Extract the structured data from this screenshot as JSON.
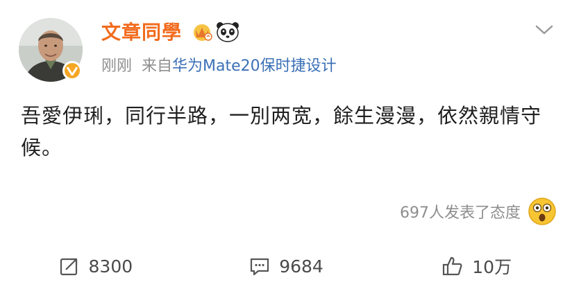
{
  "post": {
    "author": "文章同學",
    "time": "刚刚",
    "source_prefix": "来自",
    "device": "华为Mate20保时捷设计",
    "content": "吾愛伊琍，同行半路，一別两宽，餘生漫漫，依然親情守候。",
    "reactions": "697人发表了态度"
  },
  "badges": {
    "verified_icon": "verified-v-icon",
    "crown_icon": "crown-badge-icon",
    "panda_icon": "panda-badge-icon"
  },
  "actions": {
    "repost": {
      "icon": "repost-icon",
      "count": "8300"
    },
    "comment": {
      "icon": "comment-icon",
      "count": "9684"
    },
    "like": {
      "icon": "thumbs-up-icon",
      "count": "10万"
    }
  },
  "colors": {
    "author_name": "#f26b1d",
    "device_link": "#3b6fb6",
    "meta_text": "#8e8e8e",
    "verified_badge": "#f5a623"
  }
}
